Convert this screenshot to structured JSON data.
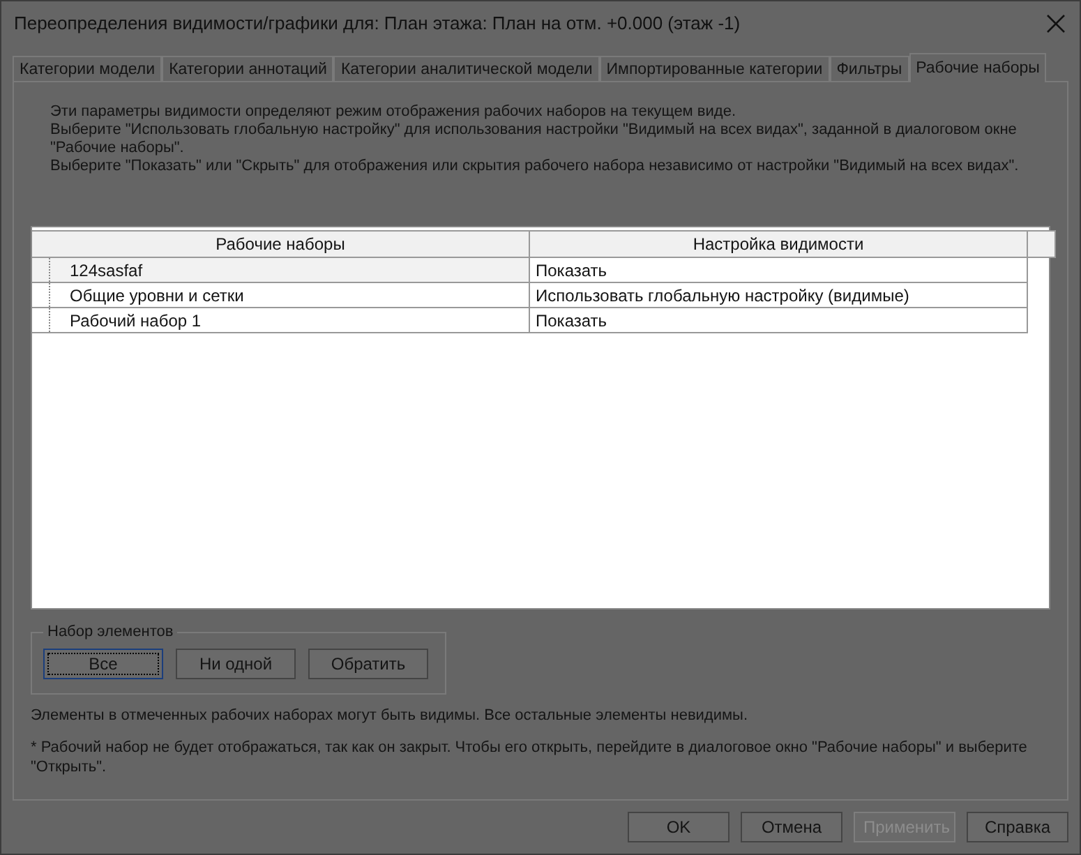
{
  "window": {
    "title": "Переопределения видимости/графики для: План этажа: План на отм. +0.000 (этаж -1)"
  },
  "tabs": [
    {
      "label": "Категории модели",
      "selected": false
    },
    {
      "label": "Категории аннотаций",
      "selected": false
    },
    {
      "label": "Категории аналитической модели",
      "selected": false
    },
    {
      "label": "Импортированные категории",
      "selected": false
    },
    {
      "label": "Фильтры",
      "selected": false
    },
    {
      "label": "Рабочие наборы",
      "selected": true
    }
  ],
  "intro": [
    "Эти параметры видимости определяют режим отображения рабочих наборов на текущем виде.",
    "Выберите \"Использовать глобальную настройку\" для использования настройки \"Видимый на всех видах\", заданной в диалоговом окне \"Рабочие наборы\".",
    "Выберите \"Показать\" или \"Скрыть\" для отображения или скрытия рабочего набора независимо от настройки \"Видимый на всех видах\"."
  ],
  "table": {
    "columns": [
      "Рабочие наборы",
      "Настройка видимости"
    ],
    "rows": [
      {
        "name": "124sasfaf",
        "visibility": "Показать",
        "selected": true
      },
      {
        "name": "Общие уровни и сетки",
        "visibility": "Использовать глобальную настройку (видимые)",
        "selected": false
      },
      {
        "name": "Рабочий набор 1",
        "visibility": "Показать",
        "selected": false
      }
    ]
  },
  "element_set": {
    "title": "Набор элементов",
    "buttons": [
      {
        "label": "Все",
        "focused": true
      },
      {
        "label": "Ни одной",
        "focused": false
      },
      {
        "label": "Обратить",
        "focused": false
      }
    ]
  },
  "notes": [
    "Элементы в отмеченных рабочих наборах могут быть видимы.  Все остальные элементы невидимы.",
    "* Рабочий набор не будет отображаться, так как он закрыт. Чтобы его открыть, перейдите в диалоговое окно \"Рабочие наборы\" и выберите \"Открыть\"."
  ],
  "footer_buttons": [
    {
      "label": "OK",
      "disabled": false
    },
    {
      "label": "Отмена",
      "disabled": false
    },
    {
      "label": "Применить",
      "disabled": true
    },
    {
      "label": "Справка",
      "disabled": false
    }
  ]
}
